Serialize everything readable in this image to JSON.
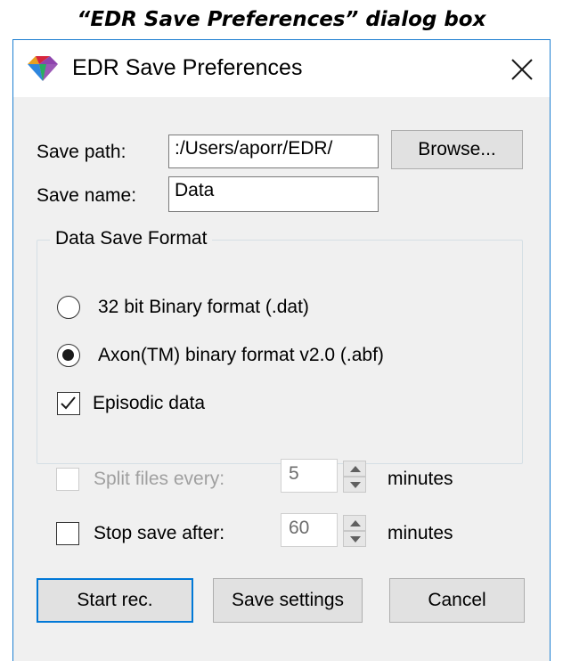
{
  "caption": "“EDR Save Preferences” dialog box",
  "window": {
    "title": "EDR Save Preferences"
  },
  "save_path": {
    "label": "Save path:",
    "value": ":/Users/aporr/EDR/"
  },
  "browse_button": "Browse...",
  "save_name": {
    "label": "Save name:",
    "value": "Data"
  },
  "format_group": {
    "title": "Data Save Format",
    "options": [
      {
        "label": "32 bit Binary format (.dat)",
        "selected": false
      },
      {
        "label": "Axon(TM) binary format v2.0 (.abf)",
        "selected": true
      }
    ],
    "episodic": {
      "label": "Episodic data",
      "checked": true
    }
  },
  "split_files": {
    "label": "Split files every:",
    "value": "5",
    "unit": "minutes",
    "checked": false,
    "enabled": false
  },
  "stop_save": {
    "label": "Stop save after:",
    "value": "60",
    "unit": "minutes",
    "checked": false,
    "enabled": true
  },
  "buttons": {
    "start": "Start rec.",
    "save_settings": "Save settings",
    "cancel": "Cancel"
  },
  "icons": {
    "app": "edr-app-icon",
    "close": "close-icon"
  }
}
